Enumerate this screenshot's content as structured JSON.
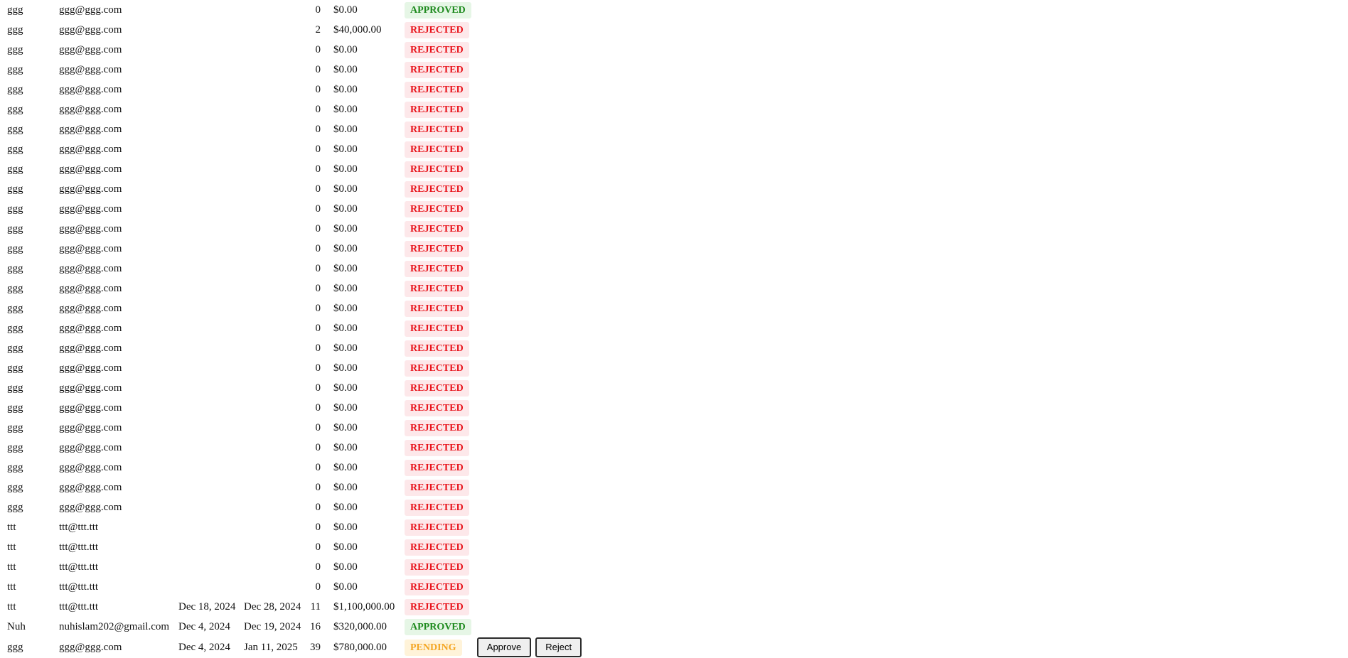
{
  "table": {
    "rows": [
      {
        "name": "ggg",
        "email": "ggg@ggg.com",
        "start_date": "",
        "end_date": "",
        "days": "0",
        "amount": "$0.00",
        "status": "APPROVED",
        "status_kind": "approved"
      },
      {
        "name": "ggg",
        "email": "ggg@ggg.com",
        "start_date": "",
        "end_date": "",
        "days": "2",
        "amount": "$40,000.00",
        "status": "REJECTED",
        "status_kind": "rejected"
      },
      {
        "name": "ggg",
        "email": "ggg@ggg.com",
        "start_date": "",
        "end_date": "",
        "days": "0",
        "amount": "$0.00",
        "status": "REJECTED",
        "status_kind": "rejected"
      },
      {
        "name": "ggg",
        "email": "ggg@ggg.com",
        "start_date": "",
        "end_date": "",
        "days": "0",
        "amount": "$0.00",
        "status": "REJECTED",
        "status_kind": "rejected"
      },
      {
        "name": "ggg",
        "email": "ggg@ggg.com",
        "start_date": "",
        "end_date": "",
        "days": "0",
        "amount": "$0.00",
        "status": "REJECTED",
        "status_kind": "rejected"
      },
      {
        "name": "ggg",
        "email": "ggg@ggg.com",
        "start_date": "",
        "end_date": "",
        "days": "0",
        "amount": "$0.00",
        "status": "REJECTED",
        "status_kind": "rejected"
      },
      {
        "name": "ggg",
        "email": "ggg@ggg.com",
        "start_date": "",
        "end_date": "",
        "days": "0",
        "amount": "$0.00",
        "status": "REJECTED",
        "status_kind": "rejected"
      },
      {
        "name": "ggg",
        "email": "ggg@ggg.com",
        "start_date": "",
        "end_date": "",
        "days": "0",
        "amount": "$0.00",
        "status": "REJECTED",
        "status_kind": "rejected"
      },
      {
        "name": "ggg",
        "email": "ggg@ggg.com",
        "start_date": "",
        "end_date": "",
        "days": "0",
        "amount": "$0.00",
        "status": "REJECTED",
        "status_kind": "rejected"
      },
      {
        "name": "ggg",
        "email": "ggg@ggg.com",
        "start_date": "",
        "end_date": "",
        "days": "0",
        "amount": "$0.00",
        "status": "REJECTED",
        "status_kind": "rejected"
      },
      {
        "name": "ggg",
        "email": "ggg@ggg.com",
        "start_date": "",
        "end_date": "",
        "days": "0",
        "amount": "$0.00",
        "status": "REJECTED",
        "status_kind": "rejected"
      },
      {
        "name": "ggg",
        "email": "ggg@ggg.com",
        "start_date": "",
        "end_date": "",
        "days": "0",
        "amount": "$0.00",
        "status": "REJECTED",
        "status_kind": "rejected"
      },
      {
        "name": "ggg",
        "email": "ggg@ggg.com",
        "start_date": "",
        "end_date": "",
        "days": "0",
        "amount": "$0.00",
        "status": "REJECTED",
        "status_kind": "rejected"
      },
      {
        "name": "ggg",
        "email": "ggg@ggg.com",
        "start_date": "",
        "end_date": "",
        "days": "0",
        "amount": "$0.00",
        "status": "REJECTED",
        "status_kind": "rejected"
      },
      {
        "name": "ggg",
        "email": "ggg@ggg.com",
        "start_date": "",
        "end_date": "",
        "days": "0",
        "amount": "$0.00",
        "status": "REJECTED",
        "status_kind": "rejected"
      },
      {
        "name": "ggg",
        "email": "ggg@ggg.com",
        "start_date": "",
        "end_date": "",
        "days": "0",
        "amount": "$0.00",
        "status": "REJECTED",
        "status_kind": "rejected"
      },
      {
        "name": "ggg",
        "email": "ggg@ggg.com",
        "start_date": "",
        "end_date": "",
        "days": "0",
        "amount": "$0.00",
        "status": "REJECTED",
        "status_kind": "rejected"
      },
      {
        "name": "ggg",
        "email": "ggg@ggg.com",
        "start_date": "",
        "end_date": "",
        "days": "0",
        "amount": "$0.00",
        "status": "REJECTED",
        "status_kind": "rejected"
      },
      {
        "name": "ggg",
        "email": "ggg@ggg.com",
        "start_date": "",
        "end_date": "",
        "days": "0",
        "amount": "$0.00",
        "status": "REJECTED",
        "status_kind": "rejected"
      },
      {
        "name": "ggg",
        "email": "ggg@ggg.com",
        "start_date": "",
        "end_date": "",
        "days": "0",
        "amount": "$0.00",
        "status": "REJECTED",
        "status_kind": "rejected"
      },
      {
        "name": "ggg",
        "email": "ggg@ggg.com",
        "start_date": "",
        "end_date": "",
        "days": "0",
        "amount": "$0.00",
        "status": "REJECTED",
        "status_kind": "rejected"
      },
      {
        "name": "ggg",
        "email": "ggg@ggg.com",
        "start_date": "",
        "end_date": "",
        "days": "0",
        "amount": "$0.00",
        "status": "REJECTED",
        "status_kind": "rejected"
      },
      {
        "name": "ggg",
        "email": "ggg@ggg.com",
        "start_date": "",
        "end_date": "",
        "days": "0",
        "amount": "$0.00",
        "status": "REJECTED",
        "status_kind": "rejected"
      },
      {
        "name": "ggg",
        "email": "ggg@ggg.com",
        "start_date": "",
        "end_date": "",
        "days": "0",
        "amount": "$0.00",
        "status": "REJECTED",
        "status_kind": "rejected"
      },
      {
        "name": "ggg",
        "email": "ggg@ggg.com",
        "start_date": "",
        "end_date": "",
        "days": "0",
        "amount": "$0.00",
        "status": "REJECTED",
        "status_kind": "rejected"
      },
      {
        "name": "ggg",
        "email": "ggg@ggg.com",
        "start_date": "",
        "end_date": "",
        "days": "0",
        "amount": "$0.00",
        "status": "REJECTED",
        "status_kind": "rejected"
      },
      {
        "name": "ttt",
        "email": "ttt@ttt.ttt",
        "start_date": "",
        "end_date": "",
        "days": "0",
        "amount": "$0.00",
        "status": "REJECTED",
        "status_kind": "rejected"
      },
      {
        "name": "ttt",
        "email": "ttt@ttt.ttt",
        "start_date": "",
        "end_date": "",
        "days": "0",
        "amount": "$0.00",
        "status": "REJECTED",
        "status_kind": "rejected"
      },
      {
        "name": "ttt",
        "email": "ttt@ttt.ttt",
        "start_date": "",
        "end_date": "",
        "days": "0",
        "amount": "$0.00",
        "status": "REJECTED",
        "status_kind": "rejected"
      },
      {
        "name": "ttt",
        "email": "ttt@ttt.ttt",
        "start_date": "",
        "end_date": "",
        "days": "0",
        "amount": "$0.00",
        "status": "REJECTED",
        "status_kind": "rejected"
      },
      {
        "name": "ttt",
        "email": "ttt@ttt.ttt",
        "start_date": "Dec 18, 2024",
        "end_date": "Dec 28, 2024",
        "days": "11",
        "amount": "$1,100,000.00",
        "status": "REJECTED",
        "status_kind": "rejected"
      },
      {
        "name": "Nuh",
        "email": "nuhislam202@gmail.com",
        "start_date": "Dec 4, 2024",
        "end_date": "Dec 19, 2024",
        "days": "16",
        "amount": "$320,000.00",
        "status": "APPROVED",
        "status_kind": "approved"
      },
      {
        "name": "ggg",
        "email": "ggg@ggg.com",
        "start_date": "Dec 4, 2024",
        "end_date": "Jan 11, 2025",
        "days": "39",
        "amount": "$780,000.00",
        "status": "PENDING",
        "status_kind": "pending",
        "actions": {
          "approve_label": "Approve",
          "reject_label": "Reject"
        }
      }
    ]
  },
  "colors": {
    "approved_text": "#1e8a1e",
    "approved_bg": "#e6f6e6",
    "rejected_text": "#e8131b",
    "rejected_bg": "#fde8ea",
    "pending_text": "#f4a623",
    "pending_bg": "#fff3d9"
  }
}
